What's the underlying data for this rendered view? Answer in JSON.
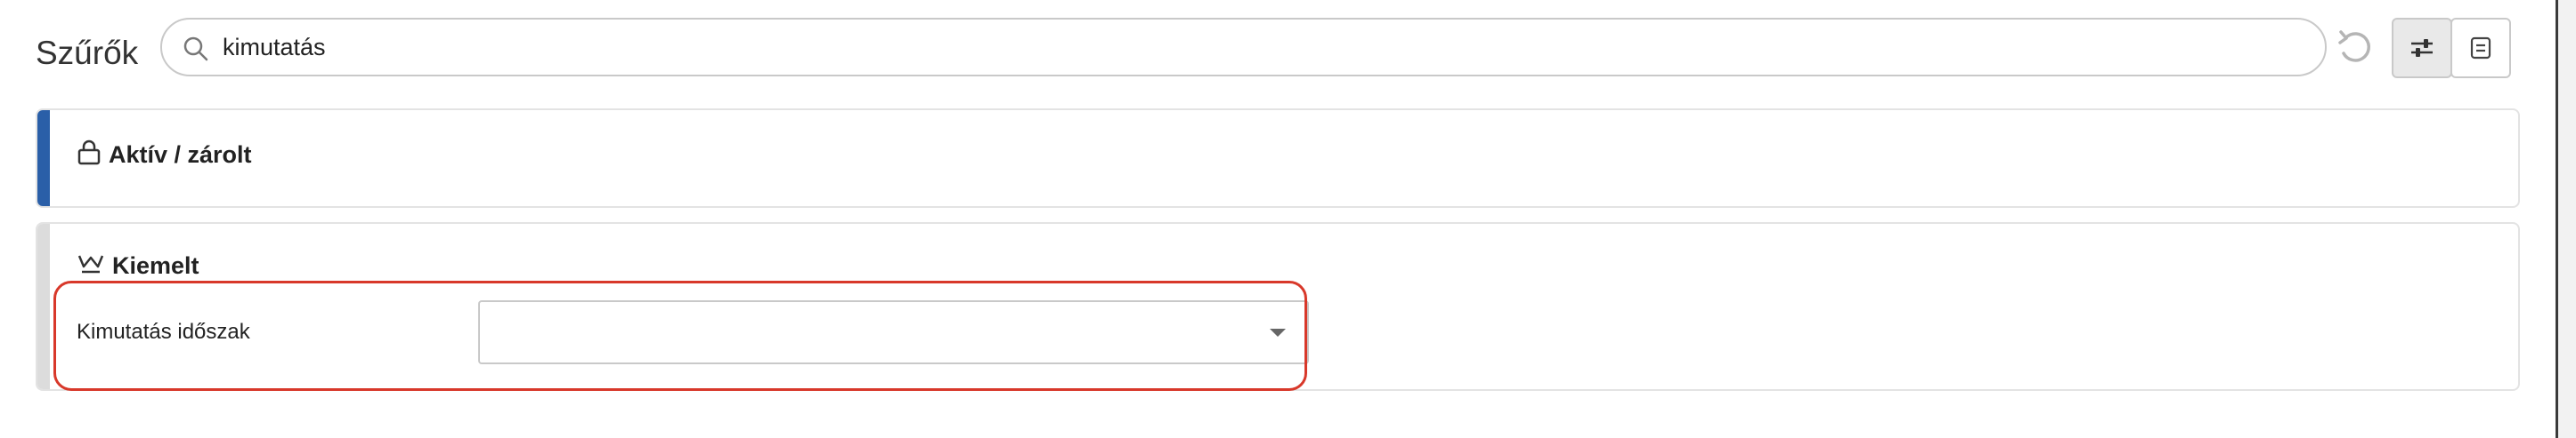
{
  "filter_bar": {
    "title": "Szűrők",
    "search_value": "kimutatás",
    "search_icon": "search-icon",
    "undo_icon": "undo-icon",
    "filter_toggle_icon": "sliders-icon",
    "list_view_icon": "list-icon"
  },
  "panels": [
    {
      "title": "Aktív / zárolt",
      "icon": "lock-icon",
      "accent_color": "#2a5fa8"
    },
    {
      "title": "Kiemelt",
      "icon": "crown-icon",
      "accent_color": "#dcdcdc"
    }
  ],
  "fields": [
    {
      "label": "Kimutatás időszak",
      "value": "",
      "highlight_color": "#d8382a"
    }
  ]
}
